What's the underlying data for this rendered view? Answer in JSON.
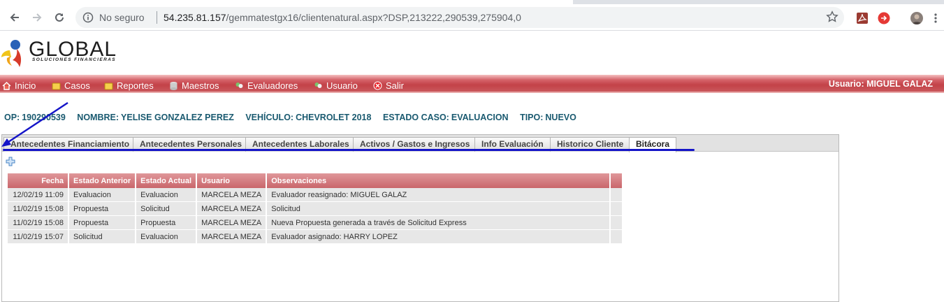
{
  "browser": {
    "security_label": "No seguro",
    "url_host": "54.235.81.157",
    "url_path": "/gemmatestgx16/clientenatural.aspx?DSP,213222,290539,275904,0"
  },
  "logo": {
    "name": "GLOBAL",
    "tagline": "SOLUCIONES FINANCIERAS"
  },
  "menu": {
    "items": [
      {
        "label": "Inicio",
        "icon": "home-icon"
      },
      {
        "label": "Casos",
        "icon": "folder-icon"
      },
      {
        "label": "Reportes",
        "icon": "folder-icon"
      },
      {
        "label": "Maestros",
        "icon": "database-icon"
      },
      {
        "label": "Evaluadores",
        "icon": "users-icon"
      },
      {
        "label": "Usuario",
        "icon": "users-icon"
      },
      {
        "label": "Salir",
        "icon": "exit-icon"
      }
    ],
    "user_prefix": "Usuario:",
    "user_name": "MIGUEL GALAZ"
  },
  "case": {
    "op_label": "OP:",
    "op_value": "190290539",
    "nombre_label": "NOMBRE:",
    "nombre_value": "YELISE GONZALEZ PEREZ",
    "vehiculo_label": "VEHÍCULO:",
    "vehiculo_value": "CHEVROLET 2018",
    "estado_label": "ESTADO CASO:",
    "estado_value": "EVALUACION",
    "tipo_label": "TIPO:",
    "tipo_value": "NUEVO"
  },
  "tabs": [
    "Antecedentes Financiamiento",
    "Antecedentes Personales",
    "Antecedentes Laborales",
    "Activos / Gastos e Ingresos",
    "Info Evaluación",
    "Historico Cliente",
    "Bitácora"
  ],
  "active_tab": "Bitácora",
  "table": {
    "columns": [
      "Fecha",
      "Estado Anterior",
      "Estado Actual",
      "Usuario",
      "Observaciones"
    ],
    "rows": [
      [
        "12/02/19 11:09",
        "Evaluacion",
        "Evaluacion",
        "MARCELA MEZA",
        "Evaluador reasignado: MIGUEL GALAZ"
      ],
      [
        "11/02/19 15:08",
        "Propuesta",
        "Solicitud",
        "MARCELA MEZA",
        "Solicitud"
      ],
      [
        "11/02/19 15:08",
        "Propuesta",
        "Propuesta",
        "MARCELA MEZA",
        "Nueva Propuesta generada a través de Solicitud Express"
      ],
      [
        "11/02/19 15:07",
        "Solicitud",
        "Evaluacion",
        "MARCELA MEZA",
        "Evaluador asignado: HARRY LOPEZ"
      ]
    ]
  },
  "colors": {
    "menu_red": "#c34248",
    "case_teal": "#1a5a70",
    "annotation_blue": "#1414c8"
  }
}
